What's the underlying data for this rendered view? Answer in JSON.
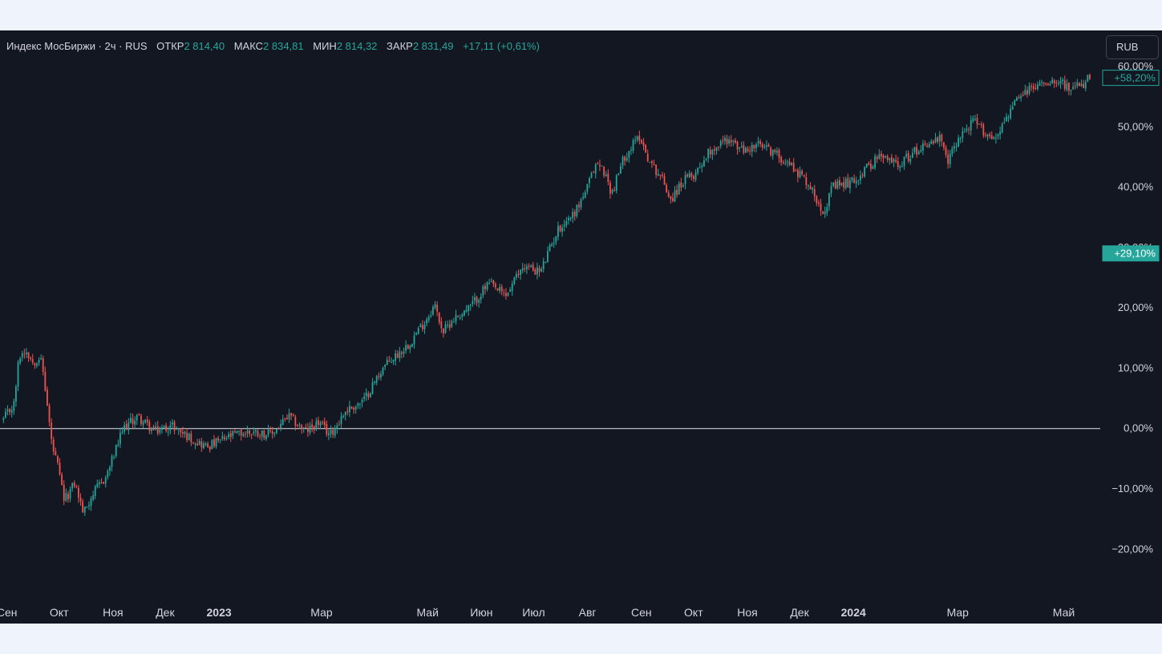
{
  "legend": {
    "symbol": "Индекс МосБиржи · 2ч · RUS",
    "open_label": "ОТКР",
    "open": "2 814,40",
    "high_label": "МАКС",
    "high": "2 834,81",
    "low_label": "МИН",
    "low": "2 814,32",
    "close_label": "ЗАКР",
    "close": "2 831,49",
    "change": "+17,11 (+0,61%)"
  },
  "currency_button": "RUB",
  "colors": {
    "up": "#26a69a",
    "down": "#ef5350",
    "background": "#131722",
    "text": "#d1d4dc",
    "zero_line": "#ffffff"
  },
  "chart_data": {
    "type": "candlestick",
    "series": [
      {
        "name": "Индекс МосБиржи",
        "x": [
          "2022-08-30",
          "2022-09-05",
          "2022-09-08",
          "2022-09-12",
          "2022-09-16",
          "2022-09-20",
          "2022-09-22",
          "2022-09-27",
          "2022-09-30",
          "2022-10-04",
          "2022-10-10",
          "2022-10-15",
          "2022-10-20",
          "2022-10-28",
          "2022-11-07",
          "2022-11-15",
          "2022-11-25",
          "2022-12-05",
          "2022-12-15",
          "2022-12-25",
          "2023-01-10",
          "2023-01-20",
          "2023-01-31",
          "2023-02-10",
          "2023-02-20",
          "2023-02-27",
          "2023-03-06",
          "2023-03-15",
          "2023-03-25",
          "2023-04-05",
          "2023-04-20",
          "2023-04-30",
          "2023-05-05",
          "2023-05-10",
          "2023-05-15",
          "2023-05-25",
          "2023-06-05",
          "2023-06-15",
          "2023-06-25",
          "2023-07-05",
          "2023-07-15",
          "2023-07-25",
          "2023-08-01",
          "2023-08-06",
          "2023-08-10",
          "2023-08-15",
          "2023-08-22",
          "2023-08-31",
          "2023-09-06",
          "2023-09-12",
          "2023-09-18",
          "2023-09-25",
          "2023-10-01",
          "2023-10-10",
          "2023-10-20",
          "2023-10-30",
          "2023-11-07",
          "2023-11-15",
          "2023-11-25",
          "2023-12-05",
          "2023-12-12",
          "2023-12-15",
          "2023-12-20",
          "2024-01-01",
          "2024-01-15",
          "2024-01-28",
          "2024-02-10",
          "2024-02-20",
          "2024-02-24",
          "2024-03-01",
          "2024-03-10",
          "2024-03-17",
          "2024-03-22",
          "2024-03-28",
          "2024-04-03",
          "2024-04-10",
          "2024-04-20",
          "2024-04-28",
          "2024-05-05",
          "2024-05-12",
          "2024-05-16"
        ],
        "y": [
          1.5,
          4.0,
          12.0,
          13.0,
          11.0,
          12.0,
          9.0,
          -3.0,
          -6.0,
          -12.0,
          -9.0,
          -14.0,
          -11.0,
          -8.0,
          0.0,
          2.0,
          -0.5,
          0.5,
          -1.5,
          -3.0,
          -1.0,
          -0.5,
          -1.0,
          2.0,
          -0.5,
          1.0,
          -1.0,
          3.0,
          4.5,
          10.0,
          14.0,
          18.0,
          20.5,
          16.0,
          18.0,
          20.0,
          24.0,
          22.0,
          27.0,
          26.0,
          33.0,
          36.0,
          40.0,
          44.0,
          43.0,
          39.0,
          45.0,
          48.5,
          44.0,
          42.0,
          38.0,
          41.0,
          42.0,
          46.0,
          48.0,
          46.0,
          47.0,
          46.0,
          44.0,
          41.0,
          37.5,
          36.0,
          40.0,
          41.0,
          45.0,
          44.0,
          47.0,
          48.0,
          44.0,
          48.0,
          51.0,
          49.0,
          48.0,
          51.0,
          54.0,
          56.0,
          57.5,
          58.0,
          56.0,
          57.0,
          58.2
        ]
      }
    ],
    "ylabel": "",
    "xlabel": "",
    "y_ticks": [
      "60,00%",
      "50,00%",
      "40,00%",
      "30,00%",
      "20,00%",
      "10,00%",
      "0,00%",
      "−10,00%",
      "−20,00%"
    ],
    "x_ticks": [
      "Сен",
      "Окт",
      "Ноя",
      "Дек",
      "2023",
      "Мар",
      "Май",
      "Июн",
      "Июл",
      "Авг",
      "Сен",
      "Окт",
      "Ноя",
      "Дек",
      "2024",
      "Мар",
      "Май"
    ],
    "ylim": [
      -27,
      62
    ],
    "xlim": [
      "2022-08-28",
      "2024-05-22"
    ],
    "price_labels": [
      "+58,20%",
      "+29,10%"
    ],
    "zero_line": 0,
    "grid": false
  }
}
